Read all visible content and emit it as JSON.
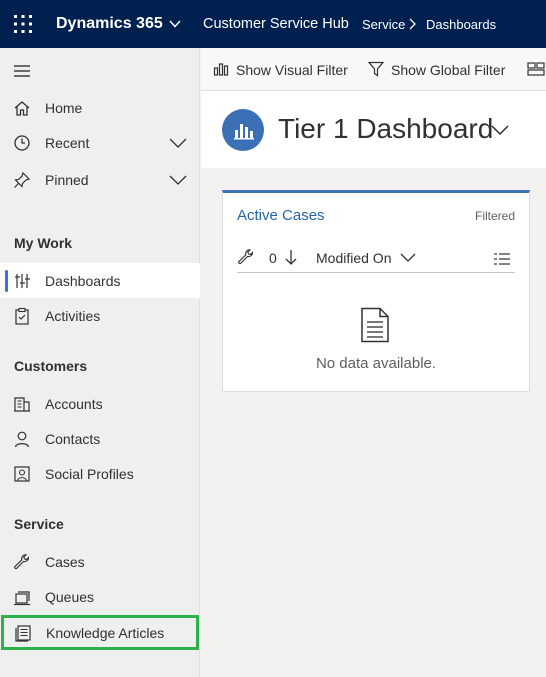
{
  "topbar": {
    "app_name": "Dynamics 365",
    "hub_name": "Customer Service Hub",
    "breadcrumb": [
      "Service",
      "Dashboards"
    ]
  },
  "sidebar": {
    "top_items": [
      {
        "label": "Home",
        "icon": "home-icon"
      },
      {
        "label": "Recent",
        "icon": "clock-icon",
        "expandable": true
      },
      {
        "label": "Pinned",
        "icon": "pin-icon",
        "expandable": true
      }
    ],
    "groups": [
      {
        "title": "My Work",
        "items": [
          {
            "label": "Dashboards",
            "icon": "dashboard-icon",
            "selected": true
          },
          {
            "label": "Activities",
            "icon": "clipboard-icon"
          }
        ]
      },
      {
        "title": "Customers",
        "items": [
          {
            "label": "Accounts",
            "icon": "building-icon"
          },
          {
            "label": "Contacts",
            "icon": "person-icon"
          },
          {
            "label": "Social Profiles",
            "icon": "profile-card-icon"
          }
        ]
      },
      {
        "title": "Service",
        "items": [
          {
            "label": "Cases",
            "icon": "wrench-icon"
          },
          {
            "label": "Queues",
            "icon": "queue-icon"
          },
          {
            "label": "Knowledge Articles",
            "icon": "article-icon",
            "highlighted": true
          }
        ]
      }
    ]
  },
  "commandbar": {
    "visual_filter": "Show Visual Filter",
    "global_filter": "Show Global Filter"
  },
  "dashboard": {
    "title": "Tier 1 Dashboard"
  },
  "panel": {
    "title": "Active Cases",
    "filter_status": "Filtered",
    "record_count": "0",
    "sort_field": "Modified On",
    "empty_message": "No data available."
  },
  "colors": {
    "topbar": "#002050",
    "accent": "#3b6fb6",
    "selection_bar": "#3a6fe0",
    "highlight_outline": "#2db24a",
    "link": "#2266aa"
  }
}
